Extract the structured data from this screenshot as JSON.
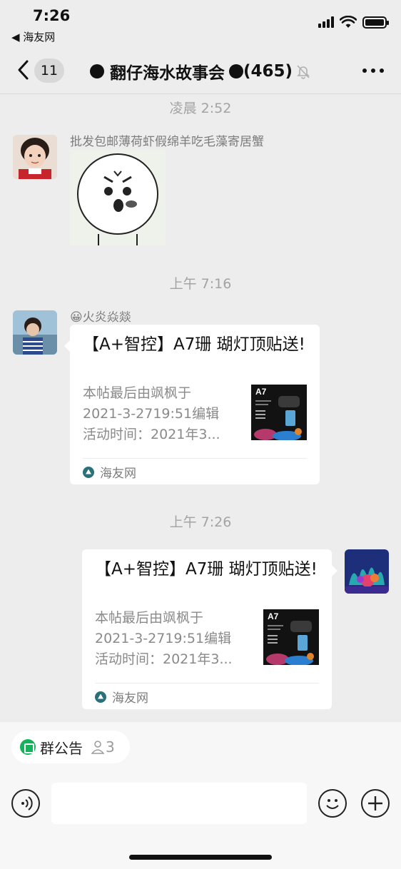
{
  "status_bar": {
    "time": "7:26",
    "back_app": "◀ 海友网"
  },
  "nav": {
    "unread_count": "11",
    "title": "翻仔海水故事会",
    "member_count": "(465)"
  },
  "messages": {
    "ts1": "凌晨 2:52",
    "msg1": {
      "text": "批发包邮薄荷虾假绵羊吃毛藻寄居蟹"
    },
    "ts2": "上午 7:16",
    "msg2": {
      "sender": "😀火炎焱燚",
      "card": {
        "title": "【A+智控】A7珊 瑚灯顶贴送!",
        "desc_lines": [
          "本帖最后由飒枫于",
          "2021-3-2719:51编辑",
          "活动时间：2021年3..."
        ],
        "thumb_text": "A7",
        "source": "海友网"
      }
    },
    "ts3": "上午 7:26",
    "msg3": {
      "card": {
        "title": "【A+智控】A7珊 瑚灯顶贴送!",
        "desc_lines": [
          "本帖最后由飒枫于",
          "2021-3-2719:51编辑",
          "活动时间：2021年3..."
        ],
        "thumb_text": "A7",
        "source": "海友网"
      }
    }
  },
  "bottom": {
    "announcement_label": "群公告",
    "announcement_count": "3"
  },
  "colors": {
    "background": "#ededed",
    "bubble": "#ffffff",
    "accent_green": "#13b35c",
    "muted_text": "#a3a3a3"
  }
}
